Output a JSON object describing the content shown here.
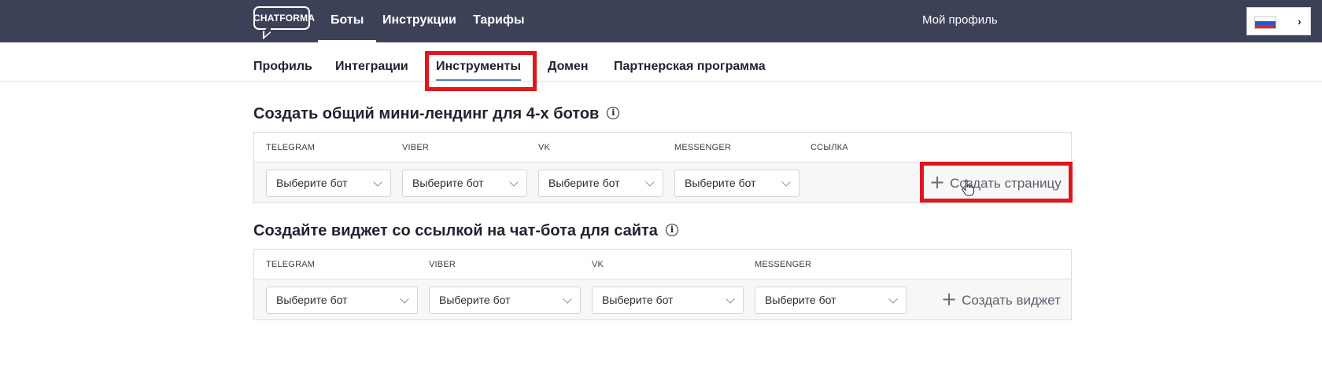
{
  "navbar": {
    "logo_text": "CHATFORMA",
    "items": [
      {
        "label": "Боты",
        "active": true
      },
      {
        "label": "Инструкции",
        "active": false
      },
      {
        "label": "Тарифы",
        "active": false
      }
    ],
    "profile_label": "Мой профиль",
    "language_flag": "russia-flag-icon"
  },
  "subtabs": [
    {
      "label": "Профиль",
      "active": false
    },
    {
      "label": "Интеграции",
      "active": false
    },
    {
      "label": "Инструменты",
      "active": true
    },
    {
      "label": "Домен",
      "active": false
    },
    {
      "label": "Партнерская программа",
      "active": false
    }
  ],
  "landing": {
    "title": "Создать общий мини-лендинг для 4-х ботов",
    "columns": [
      "TELEGRAM",
      "VIBER",
      "VK",
      "MESSENGER",
      "ССЫЛКА"
    ],
    "selects": [
      "Выберите бот",
      "Выберите бот",
      "Выберите бот",
      "Выберите бот"
    ],
    "create_label": "Создать страницу"
  },
  "widget": {
    "title": "Создайте виджет со ссылкой на чат-бота для сайта",
    "columns": [
      "TELEGRAM",
      "VIBER",
      "VK",
      "MESSENGER"
    ],
    "selects": [
      "Выберите бот",
      "Выберите бот",
      "Выберите бот",
      "Выберите бот"
    ],
    "create_label": "Создать виджет"
  },
  "colors": {
    "navbar_bg": "#3d4158",
    "highlight": "#e0161e",
    "tab_underline": "#4d7fd0"
  }
}
